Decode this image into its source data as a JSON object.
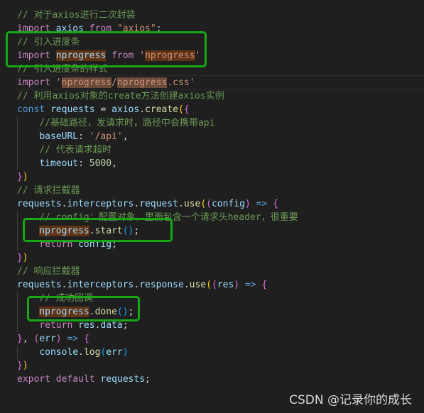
{
  "colors": {
    "comment": "#6a9955",
    "keyword": "#c586c0",
    "storage": "#569cd6",
    "variable": "#9cdcfe",
    "function": "#dcdcaa",
    "string": "#ce9178",
    "number": "#b5cea8",
    "punct": "#d4d4d4",
    "brace1": "#ffd700",
    "brace2": "#da70d6",
    "brace3": "#179fff",
    "highlight_box": "#16a816"
  },
  "lines": [
    {
      "tokens": [
        {
          "t": "// 对于axios进行二次封装",
          "k": "comment"
        }
      ]
    },
    {
      "tokens": [
        {
          "t": "import",
          "k": "keyword"
        },
        {
          "t": " "
        },
        {
          "t": "axios",
          "k": "variable"
        },
        {
          "t": " "
        },
        {
          "t": "from",
          "k": "keyword"
        },
        {
          "t": " "
        },
        {
          "t": "\"axios\"",
          "k": "string"
        },
        {
          "t": ";",
          "k": "punct"
        }
      ]
    },
    {
      "tokens": [
        {
          "t": "// 引入进度条",
          "k": "comment"
        }
      ]
    },
    {
      "tokens": [
        {
          "t": "import",
          "k": "keyword"
        },
        {
          "t": " "
        },
        {
          "t": "nprogress",
          "k": "variable",
          "hl": 1
        },
        {
          "t": " "
        },
        {
          "t": "from",
          "k": "keyword"
        },
        {
          "t": " "
        },
        {
          "t": "'",
          "k": "string"
        },
        {
          "t": "nprogress",
          "k": "string",
          "hl": 1
        },
        {
          "t": "'",
          "k": "string"
        }
      ]
    },
    {
      "tokens": [
        {
          "t": "// 引入进度条的样式",
          "k": "comment"
        }
      ]
    },
    {
      "current": true,
      "tokens": [
        {
          "t": "import",
          "k": "keyword"
        },
        {
          "t": " "
        },
        {
          "t": "'",
          "k": "string"
        },
        {
          "t": "nprogress",
          "k": "string",
          "hl": 2
        },
        {
          "t": "/",
          "k": "string"
        },
        {
          "t": "nprogress",
          "k": "string",
          "hl": 2
        },
        {
          "t": ".css",
          "k": "string"
        },
        {
          "t": "'",
          "k": "string"
        }
      ]
    },
    {
      "tokens": [
        {
          "t": "// 利用axios对象的create方法创建axios实例",
          "k": "comment"
        }
      ]
    },
    {
      "tokens": [
        {
          "t": "const",
          "k": "storage"
        },
        {
          "t": " "
        },
        {
          "t": "requests",
          "k": "variable"
        },
        {
          "t": " = "
        },
        {
          "t": "axios",
          "k": "variable"
        },
        {
          "t": "."
        },
        {
          "t": "create",
          "k": "function"
        },
        {
          "t": "(",
          "k": "brace1"
        },
        {
          "t": "{",
          "k": "brace2"
        }
      ]
    },
    {
      "tokens": [
        {
          "t": "    "
        },
        {
          "t": "//基础路径，发请求时，路径中会携带api",
          "k": "comment"
        }
      ]
    },
    {
      "tokens": [
        {
          "t": "    "
        },
        {
          "t": "baseURL",
          "k": "variable"
        },
        {
          "t": ": "
        },
        {
          "t": "'/api'",
          "k": "string"
        },
        {
          "t": ","
        }
      ]
    },
    {
      "tokens": [
        {
          "t": "    "
        },
        {
          "t": "// 代表请求超时",
          "k": "comment"
        }
      ]
    },
    {
      "tokens": [
        {
          "t": "    "
        },
        {
          "t": "timeout",
          "k": "variable"
        },
        {
          "t": ": "
        },
        {
          "t": "5000",
          "k": "number"
        },
        {
          "t": ","
        }
      ]
    },
    {
      "tokens": [
        {
          "t": "}",
          "k": "brace2"
        },
        {
          "t": ")",
          "k": "brace1"
        }
      ]
    },
    {
      "tokens": [
        {
          "t": "// 请求拦截器",
          "k": "comment"
        }
      ]
    },
    {
      "tokens": [
        {
          "t": "requests",
          "k": "variable"
        },
        {
          "t": "."
        },
        {
          "t": "interceptors",
          "k": "variable"
        },
        {
          "t": "."
        },
        {
          "t": "request",
          "k": "variable"
        },
        {
          "t": "."
        },
        {
          "t": "use",
          "k": "function"
        },
        {
          "t": "(",
          "k": "brace1"
        },
        {
          "t": "(",
          "k": "brace2"
        },
        {
          "t": "config",
          "k": "variable"
        },
        {
          "t": ")",
          "k": "brace2"
        },
        {
          "t": " "
        },
        {
          "t": "=>",
          "k": "storage"
        },
        {
          "t": " "
        },
        {
          "t": "{",
          "k": "brace2"
        }
      ]
    },
    {
      "tokens": [
        {
          "t": "    "
        },
        {
          "t": "// config：配置对象，里面包含一个请求头header，很重要",
          "k": "comment"
        }
      ]
    },
    {
      "tokens": [
        {
          "t": "    "
        },
        {
          "t": "nprogress",
          "k": "variable",
          "hl": 1
        },
        {
          "t": "."
        },
        {
          "t": "start",
          "k": "function"
        },
        {
          "t": "()",
          "k": "brace3"
        },
        {
          "t": ";"
        }
      ]
    },
    {
      "tokens": [
        {
          "t": "    "
        },
        {
          "t": "return",
          "k": "keyword"
        },
        {
          "t": " "
        },
        {
          "t": "config",
          "k": "variable"
        },
        {
          "t": ";"
        }
      ]
    },
    {
      "tokens": [
        {
          "t": "}",
          "k": "brace2"
        },
        {
          "t": ")",
          "k": "brace1"
        }
      ]
    },
    {
      "tokens": [
        {
          "t": "// 响应拦截器",
          "k": "comment"
        }
      ]
    },
    {
      "tokens": [
        {
          "t": "requests",
          "k": "variable"
        },
        {
          "t": "."
        },
        {
          "t": "interceptors",
          "k": "variable"
        },
        {
          "t": "."
        },
        {
          "t": "response",
          "k": "variable"
        },
        {
          "t": "."
        },
        {
          "t": "use",
          "k": "function"
        },
        {
          "t": "(",
          "k": "brace1"
        },
        {
          "t": "(",
          "k": "brace2"
        },
        {
          "t": "res",
          "k": "variable"
        },
        {
          "t": ")",
          "k": "brace2"
        },
        {
          "t": " "
        },
        {
          "t": "=>",
          "k": "storage"
        },
        {
          "t": " "
        },
        {
          "t": "{",
          "k": "brace2"
        }
      ]
    },
    {
      "tokens": [
        {
          "t": "    "
        },
        {
          "t": "// 成功回调",
          "k": "comment"
        }
      ]
    },
    {
      "tokens": [
        {
          "t": "    "
        },
        {
          "t": "nprogress",
          "k": "variable",
          "hl": 1
        },
        {
          "t": "."
        },
        {
          "t": "done",
          "k": "function"
        },
        {
          "t": "()",
          "k": "brace3"
        },
        {
          "t": ";"
        }
      ]
    },
    {
      "tokens": [
        {
          "t": "    "
        },
        {
          "t": "return",
          "k": "keyword"
        },
        {
          "t": " "
        },
        {
          "t": "res",
          "k": "variable"
        },
        {
          "t": "."
        },
        {
          "t": "data",
          "k": "variable"
        },
        {
          "t": ";"
        }
      ]
    },
    {
      "tokens": [
        {
          "t": "}",
          "k": "brace2"
        },
        {
          "t": ", "
        },
        {
          "t": "(",
          "k": "brace2"
        },
        {
          "t": "err",
          "k": "variable"
        },
        {
          "t": ")",
          "k": "brace2"
        },
        {
          "t": " "
        },
        {
          "t": "=>",
          "k": "storage"
        },
        {
          "t": " "
        },
        {
          "t": "{",
          "k": "brace2"
        }
      ]
    },
    {
      "tokens": [
        {
          "t": "    "
        },
        {
          "t": "console",
          "k": "variable"
        },
        {
          "t": "."
        },
        {
          "t": "log",
          "k": "function"
        },
        {
          "t": "(",
          "k": "brace3"
        },
        {
          "t": "err",
          "k": "variable"
        },
        {
          "t": ")",
          "k": "brace3"
        }
      ]
    },
    {
      "tokens": [
        {
          "t": "}",
          "k": "brace2"
        },
        {
          "t": ")",
          "k": "brace1"
        }
      ]
    },
    {
      "tokens": [
        {
          "t": "export",
          "k": "keyword"
        },
        {
          "t": " "
        },
        {
          "t": "default",
          "k": "keyword"
        },
        {
          "t": " "
        },
        {
          "t": "requests",
          "k": "variable"
        },
        {
          "t": ";"
        }
      ]
    }
  ],
  "watermark": "CSDN @记录你的成长"
}
